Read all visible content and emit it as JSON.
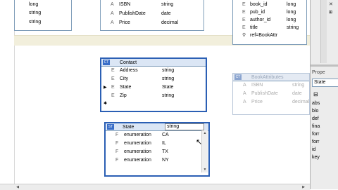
{
  "top_left_table": {
    "rows": [
      {
        "type": "long"
      },
      {
        "type": "string"
      },
      {
        "type": "string"
      }
    ]
  },
  "book_table": {
    "rows": [
      {
        "kind": "A",
        "name": "ISBN",
        "type": "string"
      },
      {
        "kind": "A",
        "name": "PublishDate",
        "type": "date"
      },
      {
        "kind": "A",
        "name": "Price",
        "type": "decimal"
      }
    ]
  },
  "bookids_table": {
    "rows": [
      {
        "kind": "E",
        "name": "book_id",
        "type": "long"
      },
      {
        "kind": "E",
        "name": "pub_id",
        "type": "long"
      },
      {
        "kind": "E",
        "name": "author_id",
        "type": "long"
      },
      {
        "kind": "E",
        "name": "title",
        "type": "string"
      },
      {
        "kind": "",
        "name": "ref=BookAttr",
        "type": ""
      }
    ]
  },
  "contact_table": {
    "title": "Contact",
    "rows": [
      {
        "kind": "E",
        "name": "Address",
        "type": "string",
        "mark": ""
      },
      {
        "kind": "E",
        "name": "City",
        "type": "string",
        "mark": ""
      },
      {
        "kind": "E",
        "name": "State",
        "type": "State",
        "mark": "▶"
      },
      {
        "kind": "E",
        "name": "Zip",
        "type": "string",
        "mark": ""
      }
    ],
    "new_row_marker": "✱"
  },
  "bookattributes_table": {
    "title": "BookAttributes",
    "rows": [
      {
        "kind": "A",
        "name": "ISBN",
        "type": "string"
      },
      {
        "kind": "A",
        "name": "PublishDate",
        "type": "date"
      },
      {
        "kind": "A",
        "name": "Price",
        "type": "decimal"
      }
    ]
  },
  "state_table": {
    "title": "State",
    "title_type": "string",
    "rows": [
      {
        "kind": "F",
        "name": "enumeration",
        "type": "CA"
      },
      {
        "kind": "F",
        "name": "enumeration",
        "type": "IL"
      },
      {
        "kind": "F",
        "name": "enumeration",
        "type": "TX"
      },
      {
        "kind": "F",
        "name": "enumeration",
        "type": "NY"
      }
    ]
  },
  "right_panel": {
    "prop_label": "Prope",
    "state_label": "State",
    "items": [
      "abs",
      "blo",
      "def",
      "fina",
      "forr",
      "forr",
      "id",
      "key"
    ]
  }
}
